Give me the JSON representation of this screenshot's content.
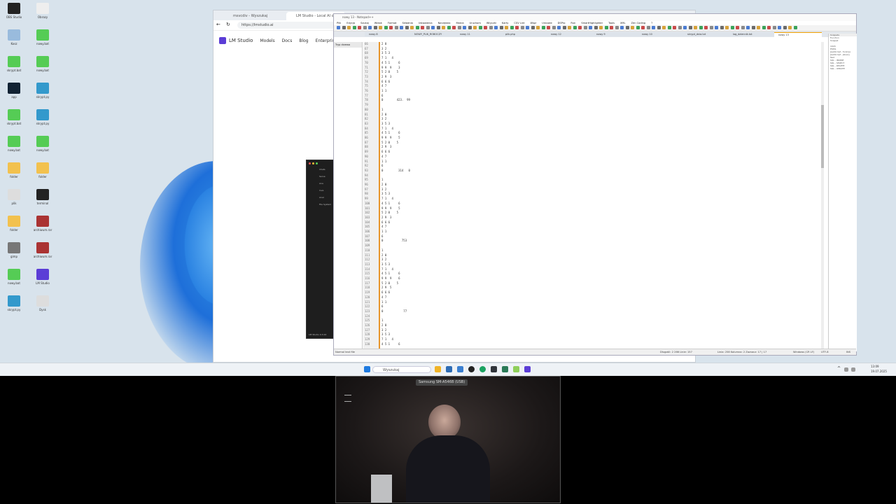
{
  "desktop": {
    "icons": [
      {
        "label": "OBS Studio",
        "color": "#222"
      },
      {
        "label": "Obrazy",
        "color": "#eee"
      },
      {
        "label": "Kosz",
        "color": "#9bd"
      },
      {
        "label": "nowy.bat",
        "color": "#5c5"
      },
      {
        "label": "skrypt.bat",
        "color": "#5c5"
      },
      {
        "label": "nowy.bat",
        "color": "#5c5"
      },
      {
        "label": "app",
        "color": "#123"
      },
      {
        "label": "skrypt.py",
        "color": "#39c"
      },
      {
        "label": "skrypt.bat",
        "color": "#5c5"
      },
      {
        "label": "skrypt.py",
        "color": "#39c"
      },
      {
        "label": "nowy.bat",
        "color": "#5c5"
      },
      {
        "label": "nowy.bat",
        "color": "#5c5"
      },
      {
        "label": "folder",
        "color": "#f2c14e"
      },
      {
        "label": "folder",
        "color": "#f2c14e"
      },
      {
        "label": "plik",
        "color": "#ddd"
      },
      {
        "label": "terminal",
        "color": "#222"
      },
      {
        "label": "folder",
        "color": "#f2c14e"
      },
      {
        "label": "archiwum.rar",
        "color": "#a33"
      },
      {
        "label": "gimp",
        "color": "#777"
      },
      {
        "label": "archiwum.rar",
        "color": "#a33"
      },
      {
        "label": "nowy.bat",
        "color": "#5c5"
      },
      {
        "label": "LM Studio",
        "color": "#5b3dd6"
      },
      {
        "label": "skrypt.py",
        "color": "#39c"
      },
      {
        "label": "Dysk",
        "color": "#ddd"
      }
    ]
  },
  "browser": {
    "tabs": [
      "msvcdiv - Wyszukaj",
      "LM Studio - Local AI on your"
    ],
    "url": "https://lmstudio.ai",
    "site": {
      "brand": "LM Studio",
      "nav": [
        "Models",
        "Docs",
        "Blog",
        "Enterprise"
      ]
    }
  },
  "darkapp": {
    "items": [
      "Chats",
      "Serve",
      "Ana",
      "Inve",
      "Anal",
      "File System"
    ],
    "footer": "LM Studio 0.3.24"
  },
  "npp": {
    "title": "nowy 13 - Notepad++",
    "menu": [
      "Plik",
      "Edycja",
      "Szukaj",
      "Widok",
      "Format",
      "Składnia",
      "Ustawienia",
      "Narzędzia",
      "Makra",
      "Uruchom",
      "Wtyczki",
      "Karty",
      "CSV Lint",
      "Wiąż",
      "Unicode",
      "DSPro",
      "Run",
      "SmartHighlighter",
      "Tools",
      "XML",
      "Zen Coding",
      "?"
    ],
    "doc_tabs": [
      "nowy 8",
      "NOWY_PLIK_ROBOCZY",
      "nowy 11",
      "plik.php",
      "nowy 12",
      "nowy 9",
      "nowy 10",
      "skrypt_dnia.txt",
      "log_dziennik.txt",
      "nowy 13"
    ],
    "left_panel_label": "Tryp drzewa",
    "right_panel_title": "Snippets",
    "right_panel_lines": [
      "Function",
      "Snippet",
      "",
      "1024",
      "HSML",
      "JavaScript - funkcja",
      "JavaScript - JQuery",
      "Test",
      "SQL - INSERT",
      "SQL - SELECT",
      "SQL - DELETE",
      "SQL - UPDATE"
    ],
    "lines": [
      {
        "n": "66",
        "t": "2 0"
      },
      {
        "n": "67",
        "t": "3 2"
      },
      {
        "n": "68",
        "t": "3 5 3"
      },
      {
        "n": "69",
        "t": "7 1   4"
      },
      {
        "n": "70",
        "t": "4 5 1     6"
      },
      {
        "n": "71",
        "t": "9 9  9    3"
      },
      {
        "n": "72",
        "t": "5 2 0    5"
      },
      {
        "n": "73",
        "t": "2 9  3"
      },
      {
        "n": "74",
        "t": "6 6 6"
      },
      {
        "n": "75",
        "t": "4 7"
      },
      {
        "n": "76",
        "t": "1 1"
      },
      {
        "n": "77",
        "t": "6"
      },
      {
        "n": "78",
        "t": "0        423.  99"
      },
      {
        "n": "79",
        "t": ""
      },
      {
        "n": "80",
        "t": "1"
      },
      {
        "n": "81",
        "t": "2 0"
      },
      {
        "n": "82",
        "t": "3 2"
      },
      {
        "n": "83",
        "t": "3 5 3"
      },
      {
        "n": "84",
        "t": "7 1   4"
      },
      {
        "n": "85",
        "t": "4 5 1     6"
      },
      {
        "n": "86",
        "t": "9 9  9    5"
      },
      {
        "n": "87",
        "t": "5 2 0    5"
      },
      {
        "n": "88",
        "t": "2 9  3"
      },
      {
        "n": "89",
        "t": "6 6 6"
      },
      {
        "n": "90",
        "t": "4 7"
      },
      {
        "n": "91",
        "t": "1 1"
      },
      {
        "n": "92",
        "t": "6"
      },
      {
        "n": "93",
        "t": "0         314   0"
      },
      {
        "n": "94",
        "t": ""
      },
      {
        "n": "95",
        "t": "1"
      },
      {
        "n": "96",
        "t": "2 0"
      },
      {
        "n": "97",
        "t": "3 2"
      },
      {
        "n": "98",
        "t": "3 5 3"
      },
      {
        "n": "99",
        "t": "7 1   4"
      },
      {
        "n": "100",
        "t": "4 5 1     6"
      },
      {
        "n": "101",
        "t": "9 9  9    5"
      },
      {
        "n": "102",
        "t": "5 2 0    5"
      },
      {
        "n": "103",
        "t": "2 9  3"
      },
      {
        "n": "104",
        "t": "6 6 6"
      },
      {
        "n": "105",
        "t": "4 7"
      },
      {
        "n": "106",
        "t": "1 1"
      },
      {
        "n": "107",
        "t": "6"
      },
      {
        "n": "108",
        "t": "0           753"
      },
      {
        "n": "109",
        "t": ""
      },
      {
        "n": "110",
        "t": "1"
      },
      {
        "n": "111",
        "t": "2 0"
      },
      {
        "n": "112",
        "t": "3 2"
      },
      {
        "n": "113",
        "t": "3 5 3"
      },
      {
        "n": "114",
        "t": "7 1   4"
      },
      {
        "n": "115",
        "t": "4 5 1     6"
      },
      {
        "n": "116",
        "t": "9 9  9    6"
      },
      {
        "n": "117",
        "t": "5 2 0    5"
      },
      {
        "n": "118",
        "t": "2 9  5"
      },
      {
        "n": "119",
        "t": "6 6 6"
      },
      {
        "n": "120",
        "t": "4 7"
      },
      {
        "n": "121",
        "t": "1 1"
      },
      {
        "n": "122",
        "t": "6"
      },
      {
        "n": "123",
        "t": "0            77"
      },
      {
        "n": "124",
        "t": ""
      },
      {
        "n": "125",
        "t": "1"
      },
      {
        "n": "126",
        "t": "2 0"
      },
      {
        "n": "127",
        "t": "3 2"
      },
      {
        "n": "128",
        "t": "3 5 3"
      },
      {
        "n": "129",
        "t": "7 1   4"
      },
      {
        "n": "130",
        "t": "4 5 1     6"
      }
    ],
    "status_left": "Normal text file",
    "status_mid": "Długość: 2 266    Linie: 157",
    "status_pos": "Linia: 258    Kolumna: 2    Zaznacz: 17 | 17",
    "status_eol": "Windows (CR LF)",
    "status_enc": "UTF-8",
    "status_ins": "INS"
  },
  "taskbar": {
    "search_placeholder": "Wyszukaj",
    "time": "13:09",
    "date": "19.07.2025"
  },
  "webcam": {
    "label": "Samsung SM-A546B (USB)"
  }
}
